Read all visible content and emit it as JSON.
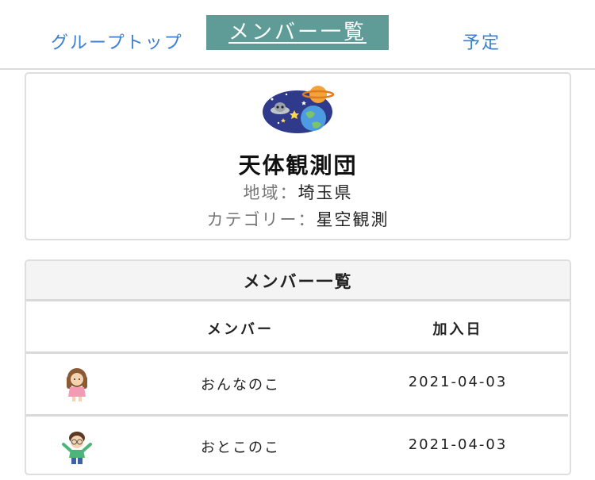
{
  "tabs": {
    "group_top": "グループトップ",
    "members": "メンバー一覧",
    "schedule": "予定"
  },
  "group": {
    "icon": "space-planet-icon",
    "name": "天体観測団",
    "region_label": "地域：",
    "region_value": "埼玉県",
    "category_label": "カテゴリー：",
    "category_value": "星空観測"
  },
  "members_section": {
    "title": "メンバー一覧",
    "columns": [
      "メンバー",
      "加入日"
    ],
    "rows": [
      {
        "avatar": "girl-avatar-icon",
        "name": "おんなのこ",
        "joined": "2021-04-03"
      },
      {
        "avatar": "boy-avatar-icon",
        "name": "おとこのこ",
        "joined": "2021-04-03"
      }
    ]
  },
  "colors": {
    "accent": "#5f9c98",
    "link": "#3b7fd1",
    "border": "#dedede"
  }
}
